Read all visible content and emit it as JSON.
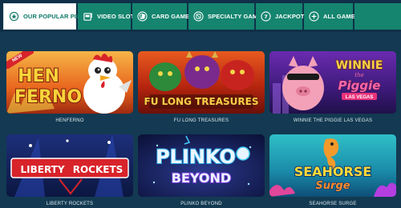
{
  "tabs": [
    {
      "label": "OUR POPULAR PICKS",
      "icon": "popular-picks-icon"
    },
    {
      "label": "VIDEO SLOTS",
      "icon": "slot-machine-icon"
    },
    {
      "label": "CARD GAMES",
      "icon": "cards-icon"
    },
    {
      "label": "SPECIALTY GAMES",
      "icon": "dice-icon"
    },
    {
      "label": "JACKPOTS",
      "icon": "jackpot-icon"
    },
    {
      "label": "ALL GAMES",
      "icon": "plus-icon"
    }
  ],
  "active_tab": "OUR POPULAR PICKS",
  "games": [
    {
      "name": "HENFERNO",
      "badge": "NEW",
      "logo_line1": "HEN",
      "logo_line2": "FERNO"
    },
    {
      "name": "FU LONG TREASURES",
      "logo_line1": "FU LONG TREASURES"
    },
    {
      "name": "WINNIE THE PIGGIE LAS VEGAS",
      "logo_line1": "WINNIE",
      "logo_line2": "the",
      "logo_line3": "Piggie",
      "logo_line4": "LAS VEGAS"
    },
    {
      "name": "LIBERTY ROCKETS",
      "logo_line1": "LIBERTY",
      "logo_line2": "ROCKETS"
    },
    {
      "name": "PLINKO BEYOND",
      "logo_line1": "PLINKO",
      "logo_line2": "BEYOND"
    },
    {
      "name": "SEAHORSE SURGE",
      "logo_line1": "SEAHORSE",
      "logo_line2": "Surge"
    }
  ],
  "colors": {
    "page_bg": "#133a52",
    "tab_bg": "#15856f",
    "tab_active_bg": "#ffffff",
    "tab_active_text": "#117a68",
    "badge_red": "#d8232a"
  }
}
